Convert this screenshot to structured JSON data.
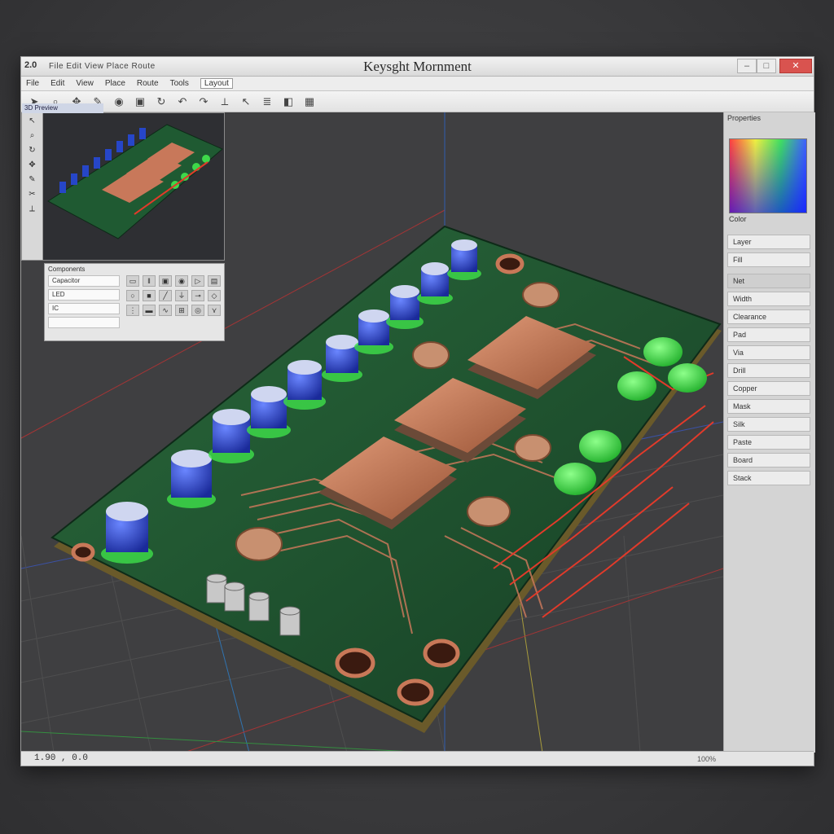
{
  "window": {
    "badge": "2.0",
    "title": "Keysght Mornment",
    "title_menu": "File  Edit  View  Place  Route"
  },
  "menubar": {
    "items": [
      "File",
      "Edit",
      "View",
      "Place",
      "Route",
      "Tools"
    ],
    "field": "Layout"
  },
  "toolbar": {
    "tools": [
      "select-icon",
      "zoom-icon",
      "pan-icon",
      "route-icon",
      "via-icon",
      "pad-icon",
      "rotate-icon",
      "undo-icon",
      "redo-icon",
      "measure-icon",
      "pointer-icon",
      "layer-icon",
      "view3d-icon",
      "grid-icon"
    ]
  },
  "preview": {
    "title": "3D Preview"
  },
  "library": {
    "title": "Components",
    "items": [
      "Capacitor",
      "LED",
      "IC"
    ]
  },
  "side_panel": {
    "title": "Properties",
    "picker_label": "Color",
    "rows": [
      "Layer",
      "Fill",
      "Net",
      "Width",
      "Clearance",
      "Pad",
      "Via",
      "Drill",
      "Copper",
      "Mask",
      "Silk",
      "Paste",
      "Board",
      "Stack"
    ]
  },
  "status": {
    "coords": "1.90 , 0.0",
    "zoom": "100%"
  },
  "colors": {
    "board": "#1f5a32",
    "copper": "#c8785a",
    "capacitor": "#2646c8",
    "led": "#3ed84a"
  }
}
